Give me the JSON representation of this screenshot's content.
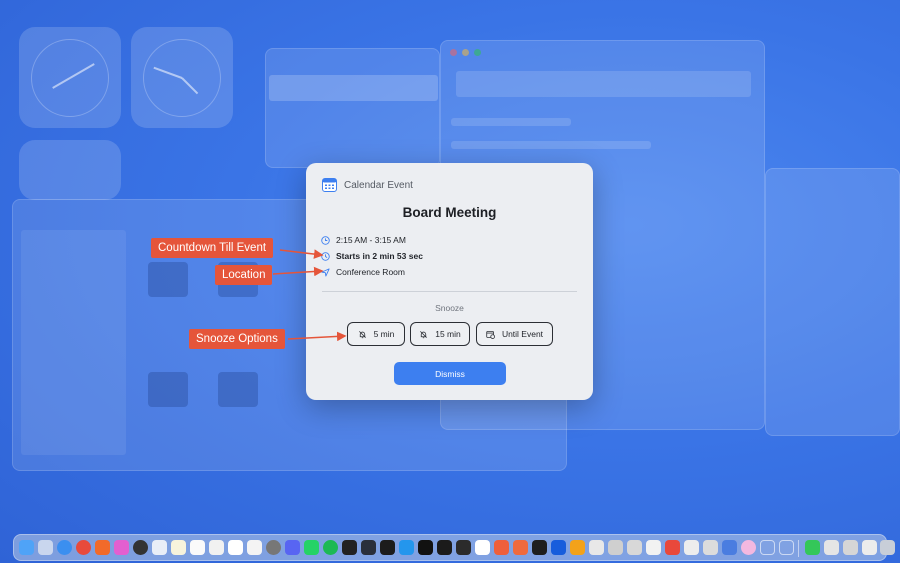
{
  "dialog": {
    "app_name": "Calendar Event",
    "title": "Board Meeting",
    "time_range": "2:15 AM - 3:15 AM",
    "countdown": "Starts in 2 min 53 sec",
    "location": "Conference Room",
    "snooze_label": "Snooze",
    "snooze_options": [
      "5 min",
      "15 min",
      "Until Event"
    ],
    "dismiss_label": "Dismiss"
  },
  "callouts": {
    "countdown": "Countdown Till Event",
    "location": "Location",
    "snooze": "Snooze Options"
  },
  "colors": {
    "accent": "#3d7ff0",
    "callout": "#e5553a",
    "desktop": "#3a78ea"
  }
}
